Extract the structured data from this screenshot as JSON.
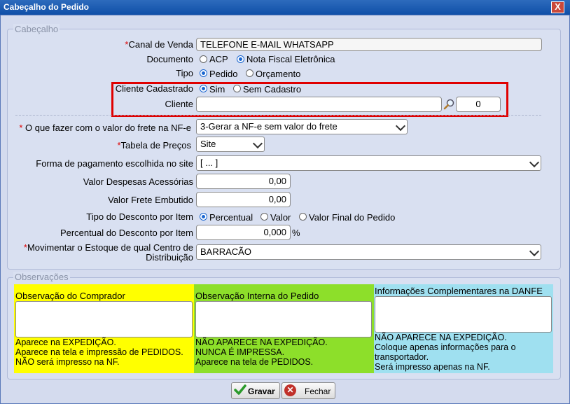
{
  "window": {
    "title": "Cabeçalho do Pedido",
    "close_label": "X"
  },
  "cabecalho": {
    "legend": "Cabeçalho",
    "canal": {
      "label": "Canal de Venda",
      "value": "TELEFONE E-MAIL WHATSAPP"
    },
    "documento": {
      "label": "Documento",
      "opt1": "ACP",
      "opt2": "Nota Fiscal Eletrônica",
      "selected": "Nota Fiscal Eletrônica"
    },
    "tipo": {
      "label": "Tipo",
      "opt1": "Pedido",
      "opt2": "Orçamento",
      "selected": "Pedido"
    },
    "cliente_cadastrado": {
      "label": "Cliente Cadastrado",
      "opt1": "Sim",
      "opt2": "Sem Cadastro",
      "selected": "Sim"
    },
    "cliente": {
      "label": "Cliente",
      "value": "",
      "code": "0"
    },
    "frete": {
      "label": "O que fazer com o valor do frete na NF-e",
      "value": "3-Gerar a NF-e sem valor do frete"
    },
    "tabela": {
      "label": "Tabela de Preços",
      "value": "Site"
    },
    "pagamento": {
      "label": "Forma de pagamento escolhida no site",
      "value": "[ ... ]"
    },
    "despesas": {
      "label": "Valor Despesas Acessórias",
      "value": "0,00"
    },
    "frete_embutido": {
      "label": "Valor Frete Embutido",
      "value": "0,00"
    },
    "tipo_desconto": {
      "label": "Tipo do Desconto por Item",
      "opt1": "Percentual",
      "opt2": "Valor",
      "opt3": "Valor Final do Pedido",
      "selected": "Percentual"
    },
    "percentual": {
      "label": "Percentual do Desconto por Item",
      "value": "0,000",
      "unit": "%"
    },
    "estoque": {
      "label_line1": "Movimentar o Estoque de qual Centro de",
      "label_line2": "Distribuição",
      "value": "BARRACÃO"
    },
    "required_mark": "*"
  },
  "observacoes": {
    "legend": "Observações",
    "comprador": {
      "title": "Observação do Comprador",
      "note1": "Aparece na EXPEDIÇÃO.",
      "note2": "Aparece na tela e impressão de PEDIDOS.",
      "note3": "NÃO será impresso na NF.",
      "color": "#ffff00"
    },
    "interna": {
      "title": "Observação Interna do Pedido",
      "note1": "NÃO APARECE NA EXPEDIÇÃO.",
      "note2": "NUNCA É IMPRESSA.",
      "note3": "Aparece na tela de PEDIDOS.",
      "color": "#8ddf2a"
    },
    "danfe": {
      "title": "Informações Complementares na DANFE",
      "note1": "NÃO APARECE NA EXPEDIÇÃO.",
      "note2": "Coloque apenas informações para o",
      "note3": "transportador.",
      "note4": "Será impresso apenas na NF.",
      "color": "#9fe0f0"
    }
  },
  "buttons": {
    "save": "Gravar",
    "close": "Fechar"
  }
}
